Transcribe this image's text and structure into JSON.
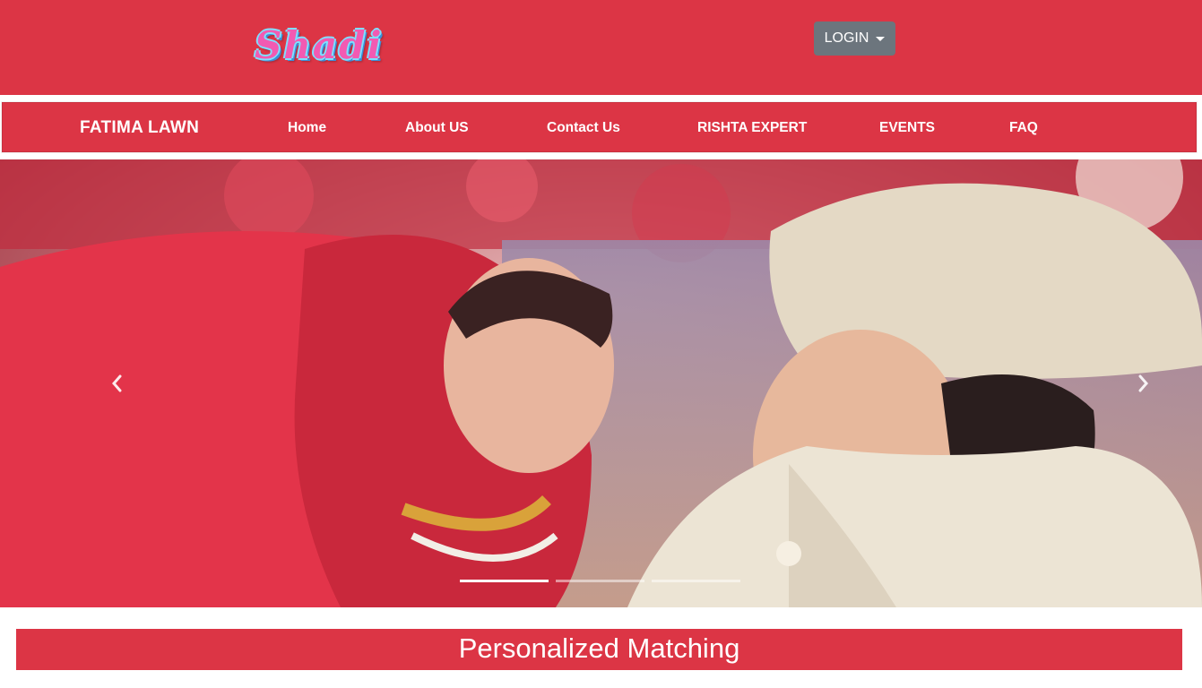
{
  "header": {
    "logo_text": "Shadi",
    "login_label": "LOGIN"
  },
  "navbar": {
    "brand": "FATIMA LAWN",
    "links": [
      "Home",
      "About US",
      "Contact Us",
      "RISHTA EXPERT",
      "EVENTS",
      "FAQ"
    ]
  },
  "carousel": {
    "prev_icon": "chevron-left-icon",
    "next_icon": "chevron-right-icon",
    "slide_count": 3,
    "active_slide": 1
  },
  "section": {
    "title": "Personalized Matching"
  },
  "colors": {
    "primary": "#dc3545",
    "secondary_button": "#6c757d",
    "logo_pink": "#f25ab2",
    "logo_outline": "#7fe0ff"
  }
}
